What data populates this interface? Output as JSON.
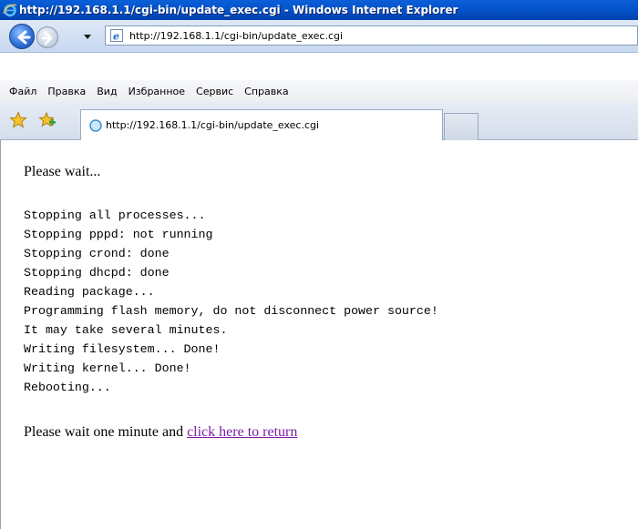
{
  "window": {
    "title": "http://192.168.1.1/cgi-bin/update_exec.cgi - Windows Internet Explorer",
    "title_icon": "ie-icon"
  },
  "toolbar": {
    "back_icon": "back-arrow-icon",
    "forward_icon": "forward-arrow-icon",
    "address": "http://192.168.1.1/cgi-bin/update_exec.cgi"
  },
  "menu": {
    "items": [
      "Файл",
      "Правка",
      "Вид",
      "Избранное",
      "Сервис",
      "Справка"
    ]
  },
  "tabs": {
    "favorites_icon": "star-icon",
    "add_favorite_icon": "add-favorite-icon",
    "active_tab_title": "http://192.168.1.1/cgi-bin/update_exec.cgi"
  },
  "content": {
    "heading": "Please wait...",
    "log_lines": [
      "Stopping all processes...",
      "Stopping pppd: not running",
      "Stopping crond: done",
      "Stopping dhcpd: done",
      "Reading package...",
      "Programming flash memory, do not disconnect power source!",
      "It may take several minutes.",
      "Writing filesystem... Done!",
      "Writing kernel... Done!",
      "Rebooting..."
    ],
    "final_prefix": "Please wait one minute and ",
    "return_link": "click here to return"
  },
  "colors": {
    "titlebar": "#0553c9",
    "link_visited": "#7a1fa2"
  }
}
